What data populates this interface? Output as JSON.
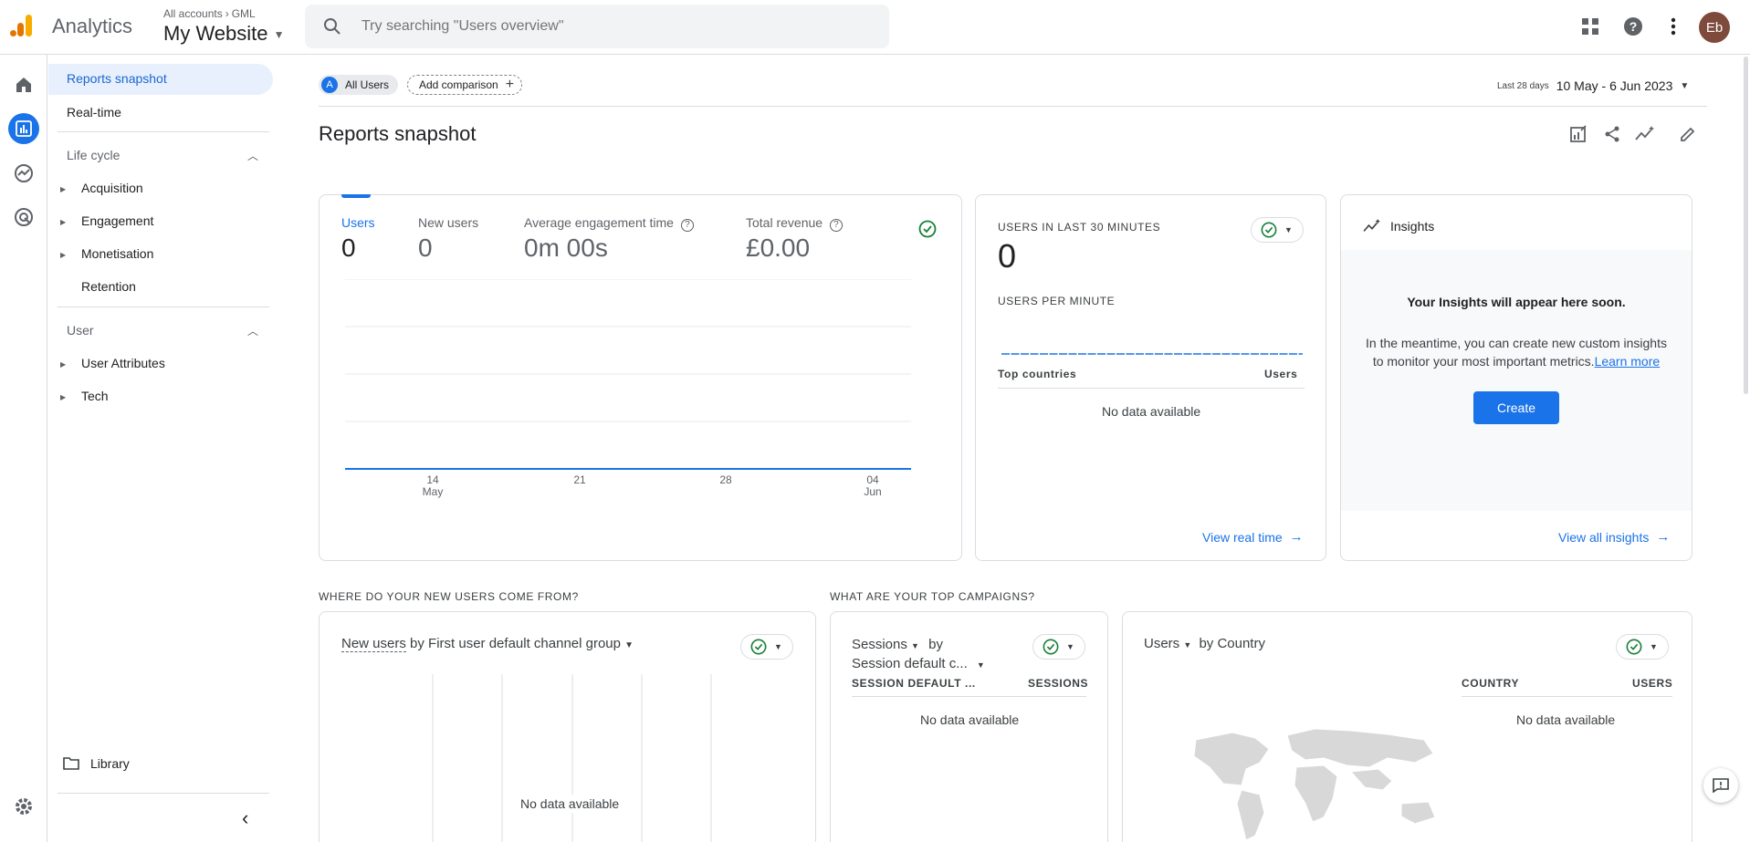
{
  "app": {
    "name": "Analytics",
    "breadcrumb": [
      "All accounts",
      "GML"
    ],
    "property": "My Website"
  },
  "search": {
    "placeholder": "Try searching \"Users overview\""
  },
  "user": {
    "initials": "Eb"
  },
  "nav": {
    "reports_snapshot": "Reports snapshot",
    "realtime": "Real-time",
    "lifecycle": {
      "title": "Life cycle",
      "items": [
        "Acquisition",
        "Engagement",
        "Monetisation",
        "Retention"
      ]
    },
    "user": {
      "title": "User",
      "items": [
        "User Attributes",
        "Tech"
      ]
    },
    "library": "Library"
  },
  "comparison": {
    "segment_initial": "A",
    "segment": "All Users",
    "add": "Add comparison"
  },
  "date": {
    "range_label": "Last 28 days",
    "range": "10 May - 6 Jun 2023"
  },
  "page_title": "Reports snapshot",
  "overview": {
    "metrics": [
      {
        "label": "Users",
        "value": "0"
      },
      {
        "label": "New users",
        "value": "0"
      },
      {
        "label": "Average engagement time",
        "value": "0m 00s"
      },
      {
        "label": "Total revenue",
        "value": "£0.00"
      }
    ],
    "chart_data": {
      "type": "line",
      "x": [
        "14 May",
        "21",
        "28",
        "04 Jun"
      ],
      "series": [
        {
          "values": [
            0,
            0,
            0,
            0
          ]
        }
      ],
      "ticks": [
        {
          "day": "14",
          "month": "May"
        },
        {
          "day": "21",
          "month": ""
        },
        {
          "day": "28",
          "month": ""
        },
        {
          "day": "04",
          "month": "Jun"
        }
      ]
    }
  },
  "realtime": {
    "title": "Users in last 30 minutes",
    "value": "0",
    "per_minute": "Users per minute",
    "col_countries": "Top countries",
    "col_users": "Users",
    "no_data": "No data available",
    "link": "View real time"
  },
  "insights": {
    "title": "Insights",
    "headline": "Your Insights will appear here soon.",
    "body": "In the meantime, you can create new custom insights to monitor your most important metrics.",
    "learn_more": "Learn more",
    "create": "Create",
    "link": "View all insights"
  },
  "acquisition": {
    "section": "Where do your new users come from?",
    "metric": "New users",
    "by": "by First user default channel group",
    "no_data": "No data available"
  },
  "campaigns": {
    "section": "What are your top campaigns?",
    "metric": "Sessions",
    "by": "by",
    "dimension": "Session default c...",
    "col_dim": "Session default ...",
    "col_metric": "Sessions",
    "no_data": "No data available"
  },
  "country": {
    "metric": "Users",
    "by": "by Country",
    "col_country": "Country",
    "col_users": "Users",
    "no_data": "No data available"
  },
  "colors": {
    "accent": "#1a73e8",
    "active_nav": "#e8f0fe",
    "check": "#188038",
    "logo_orange": "#f9ab00",
    "logo_dark": "#e37400"
  }
}
